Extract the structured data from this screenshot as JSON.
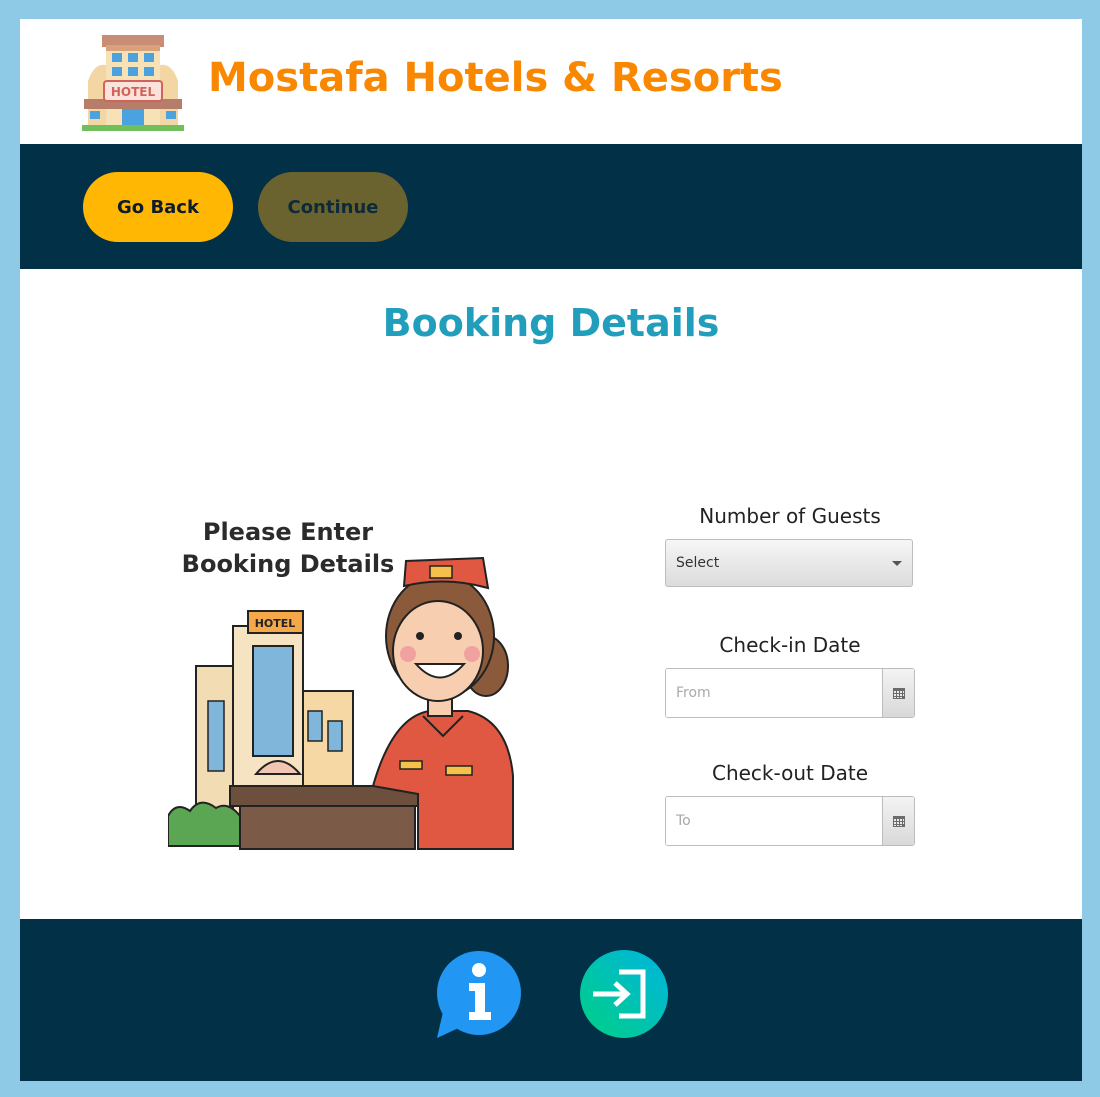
{
  "header": {
    "title": "Mostafa Hotels & Resorts",
    "logo_icon": "hotel-building-icon",
    "logo_sign_text": "HOTEL"
  },
  "toolbar": {
    "back_label": "Go Back",
    "continue_label": "Continue"
  },
  "main": {
    "section_title": "Booking Details",
    "illustration": {
      "line1": "Please Enter",
      "line2": "Booking Details",
      "hotel_sign": "HOTEL"
    },
    "form": {
      "guests_label": "Number of Guests",
      "guests_value": "Select",
      "checkin_label": "Check-in Date",
      "checkin_placeholder": "From",
      "checkout_label": "Check-out Date",
      "checkout_placeholder": "To"
    }
  },
  "footer": {
    "info_icon": "info-bubble-icon",
    "login_icon": "login-enter-icon"
  },
  "colors": {
    "outer_border": "#8ecae6",
    "navy": "#023047",
    "brand_orange": "#f98700",
    "go_back": "#ffb703",
    "continue": "#6b632f",
    "section_title": "#219ebc"
  }
}
